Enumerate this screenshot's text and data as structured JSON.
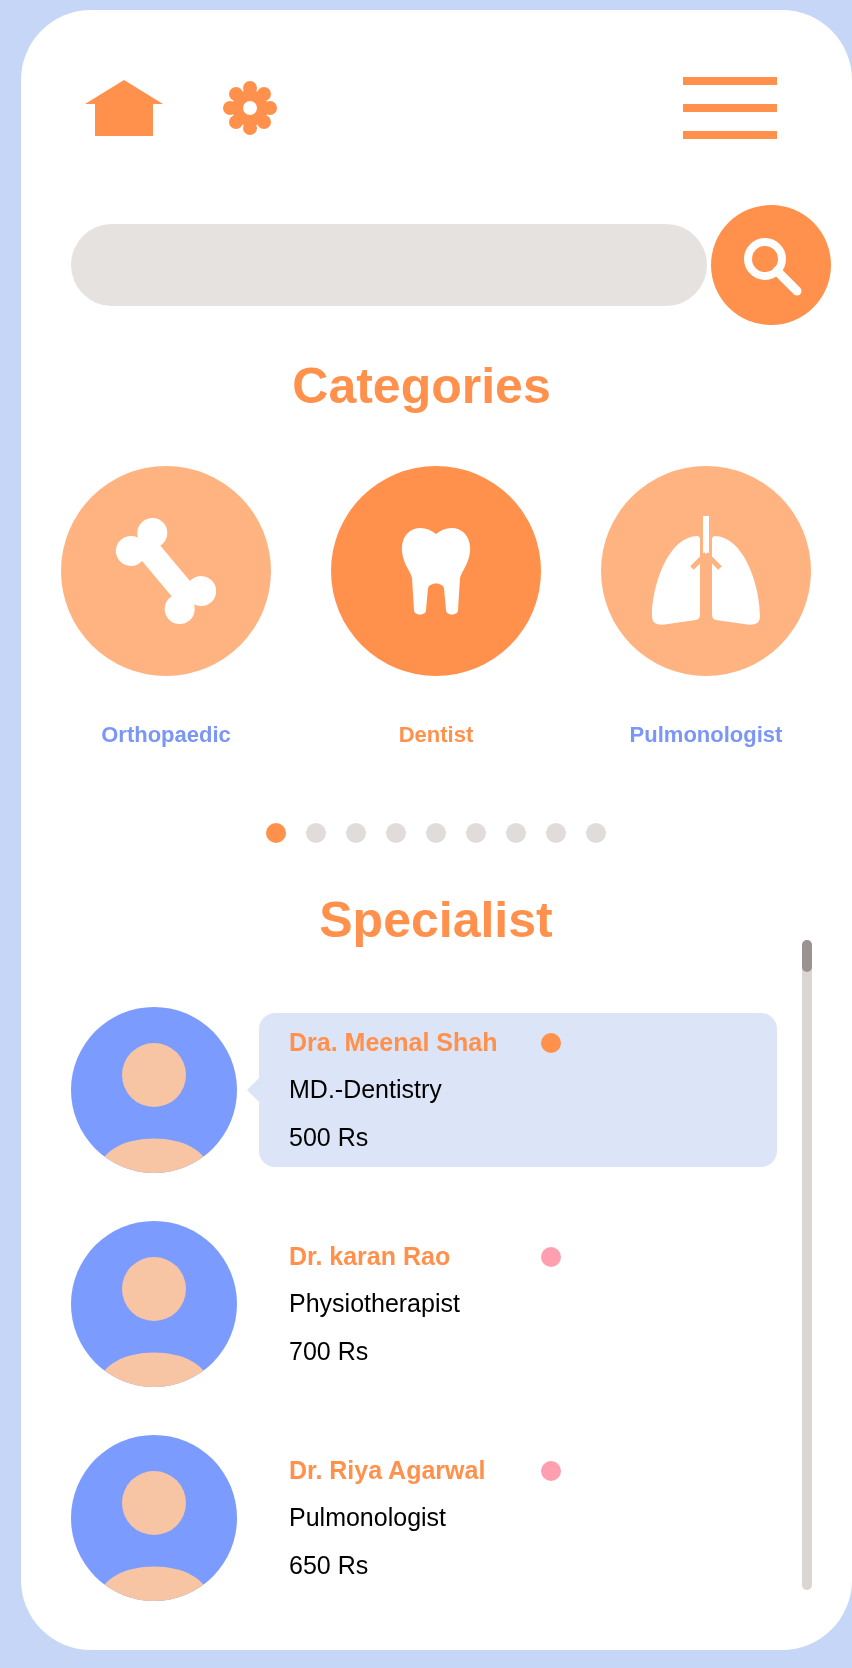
{
  "categories_title": "Categories",
  "categories": [
    {
      "label": "Orthopaedic",
      "kind": "bone",
      "selected": false
    },
    {
      "label": "Dentist",
      "kind": "tooth",
      "selected": true
    },
    {
      "label": "Pulmonologist",
      "kind": "lungs",
      "selected": false
    }
  ],
  "pager": [
    {
      "selected": true
    },
    {
      "selected": false
    },
    {
      "selected": false
    },
    {
      "selected": false
    },
    {
      "selected": false
    },
    {
      "selected": false
    },
    {
      "selected": false
    },
    {
      "selected": false
    },
    {
      "selected": false
    }
  ],
  "specialist_title": "Specialist",
  "doctors": [
    {
      "name": "Dra. Meenal Shah",
      "specialty": "MD.-Dentistry",
      "fee": "500 Rs",
      "color": "#ff914d",
      "selected": true
    },
    {
      "name": "Dr. karan Rao",
      "specialty": "Physiotherapist",
      "fee": "700 Rs",
      "color": "#ff9fb0",
      "selected": false
    },
    {
      "name": "Dr. Riya Agarwal",
      "specialty": "Pulmonologist",
      "fee": "650 Rs",
      "color": "#ff9fb0",
      "selected": false
    }
  ]
}
